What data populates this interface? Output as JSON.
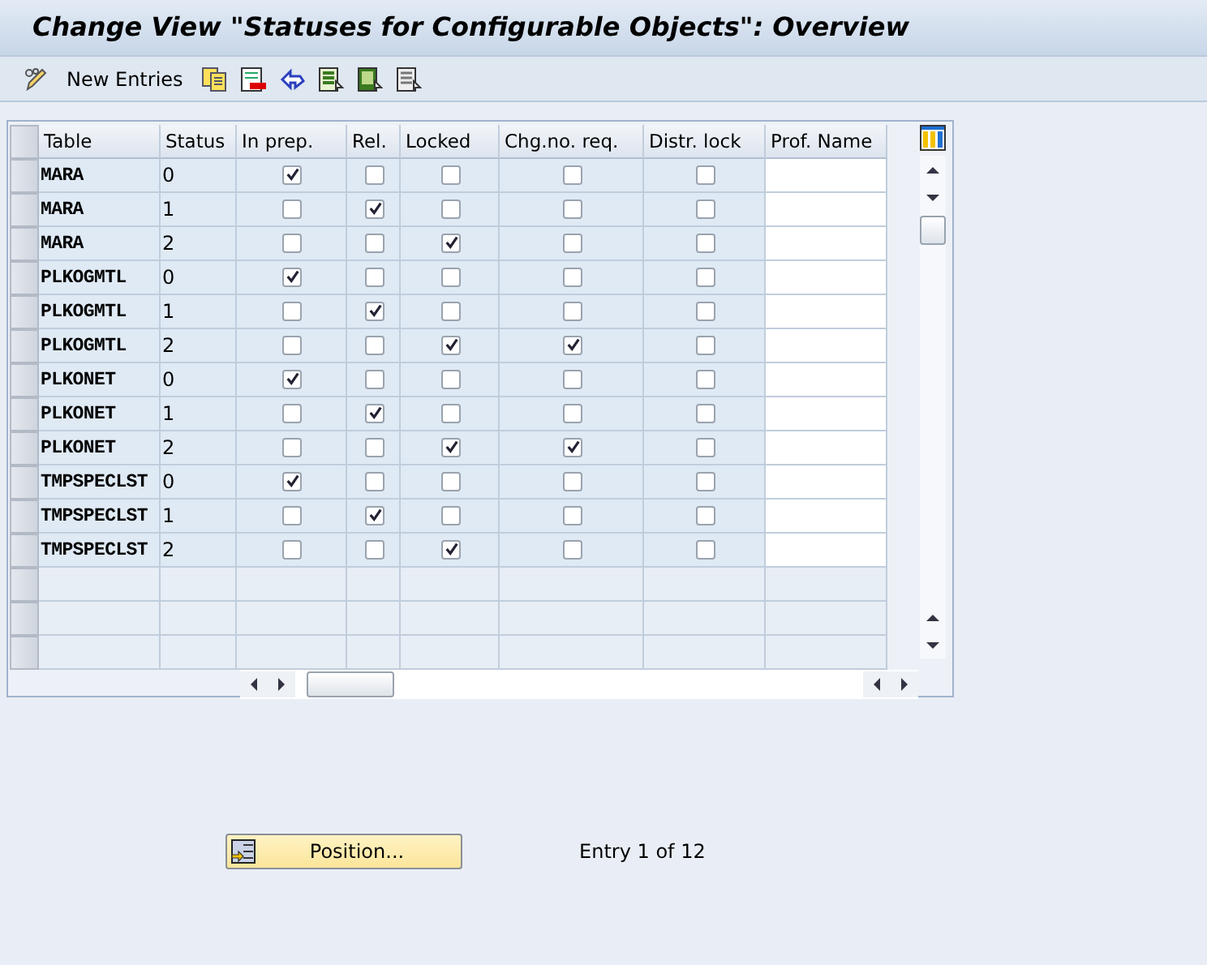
{
  "window": {
    "title": "Change View \"Statuses for Configurable Objects\": Overview"
  },
  "toolbar": {
    "new_entries": "New Entries"
  },
  "table": {
    "columns": [
      {
        "label": "Table",
        "kind": "text"
      },
      {
        "label": "Status",
        "kind": "text"
      },
      {
        "label": "In prep.",
        "kind": "check"
      },
      {
        "label": "Rel.",
        "kind": "check"
      },
      {
        "label": "Locked",
        "kind": "check"
      },
      {
        "label": "Chg.no. req.",
        "kind": "check"
      },
      {
        "label": "Distr. lock",
        "kind": "check"
      },
      {
        "label": "Prof. Name",
        "kind": "input"
      }
    ],
    "rows": [
      {
        "table": "MARA",
        "status": "0",
        "in_prep": true,
        "released": false,
        "locked": false,
        "chg_no_req": false,
        "distr_lock": false
      },
      {
        "table": "MARA",
        "status": "1",
        "in_prep": false,
        "released": true,
        "locked": false,
        "chg_no_req": false,
        "distr_lock": false
      },
      {
        "table": "MARA",
        "status": "2",
        "in_prep": false,
        "released": false,
        "locked": true,
        "chg_no_req": false,
        "distr_lock": false
      },
      {
        "table": "PLKOGMTL",
        "status": "0",
        "in_prep": true,
        "released": false,
        "locked": false,
        "chg_no_req": false,
        "distr_lock": false
      },
      {
        "table": "PLKOGMTL",
        "status": "1",
        "in_prep": false,
        "released": true,
        "locked": false,
        "chg_no_req": false,
        "distr_lock": false
      },
      {
        "table": "PLKOGMTL",
        "status": "2",
        "in_prep": false,
        "released": false,
        "locked": true,
        "chg_no_req": true,
        "distr_lock": false
      },
      {
        "table": "PLKONET",
        "status": "0",
        "in_prep": true,
        "released": false,
        "locked": false,
        "chg_no_req": false,
        "distr_lock": false
      },
      {
        "table": "PLKONET",
        "status": "1",
        "in_prep": false,
        "released": true,
        "locked": false,
        "chg_no_req": false,
        "distr_lock": false
      },
      {
        "table": "PLKONET",
        "status": "2",
        "in_prep": false,
        "released": false,
        "locked": true,
        "chg_no_req": true,
        "distr_lock": false
      },
      {
        "table": "TMPSPECLST",
        "status": "0",
        "in_prep": true,
        "released": false,
        "locked": false,
        "chg_no_req": false,
        "distr_lock": false
      },
      {
        "table": "TMPSPECLST",
        "status": "1",
        "in_prep": false,
        "released": true,
        "locked": false,
        "chg_no_req": false,
        "distr_lock": false
      },
      {
        "table": "TMPSPECLST",
        "status": "2",
        "in_prep": false,
        "released": false,
        "locked": true,
        "chg_no_req": false,
        "distr_lock": false
      }
    ]
  },
  "footer": {
    "position_button": "Position...",
    "entry_info": "Entry 1 of 12"
  }
}
